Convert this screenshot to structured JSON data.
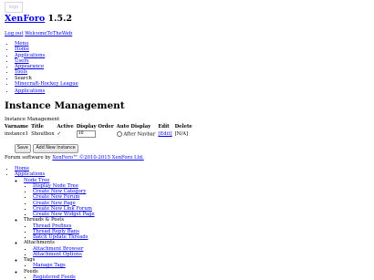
{
  "logo": {
    "text": "logo"
  },
  "header": {
    "site": "XenForo",
    "version": "1.5.2"
  },
  "user_links": {
    "logout": "Log out",
    "welcome": "WelcomeToTheWeb"
  },
  "top_nav": {
    "items": [
      {
        "label": "Menu",
        "link": true
      },
      {
        "label": "Home",
        "link": true
      },
      {
        "label": "Applications",
        "link": true
      },
      {
        "label": "Users",
        "link": true
      },
      {
        "label": "Appearance",
        "link": true
      },
      {
        "label": "Tools",
        "link": true
      },
      {
        "label": "Search",
        "link": false
      },
      {
        "label": "Minecraft-Hockey League",
        "link": true
      }
    ]
  },
  "sub_nav": {
    "applications": "Applications"
  },
  "page": {
    "title": "Instance Management",
    "caption": "Instance Management"
  },
  "table": {
    "headers": [
      "Varname",
      "Title",
      "Active",
      "Display Order",
      "Auto Display",
      "Edit",
      "Delete"
    ],
    "row": {
      "varname": "instance1",
      "title": "Shoutbox",
      "active": "✓",
      "display_order": "10",
      "auto_display": "After Navbar",
      "edit": "[Edit]",
      "delete": "[N/A]"
    }
  },
  "buttons": {
    "save": "Save",
    "add_new": "Add New Instance"
  },
  "footer": {
    "forum_software_prefix": "Forum software by ",
    "forum_software_link": "XenForo™ ©2010-2015 XenForo Ltd."
  },
  "bottom_nav": {
    "home": "Home",
    "applications": "Applications",
    "sections": [
      {
        "label": "Node Tree",
        "link": true,
        "items": [
          "Display Node Tree",
          "Create New Category",
          "Create New Forum",
          "Create New Page",
          "Create New Link Forum",
          "Create New Widget Page"
        ]
      },
      {
        "label": "Threads & Posts",
        "link": false,
        "items": [
          "Thread Prefixes",
          "Thread Reply Bans",
          "Batch Update Threads"
        ]
      },
      {
        "label": "Attachments",
        "link": false,
        "items": [
          "Attachment Browser",
          "Attachment Options"
        ]
      },
      {
        "label": "Tags",
        "link": false,
        "items": [
          "Manage Tags"
        ]
      },
      {
        "label": "Feeds",
        "link": false,
        "items": [
          "Registered Feeds"
        ]
      }
    ]
  }
}
